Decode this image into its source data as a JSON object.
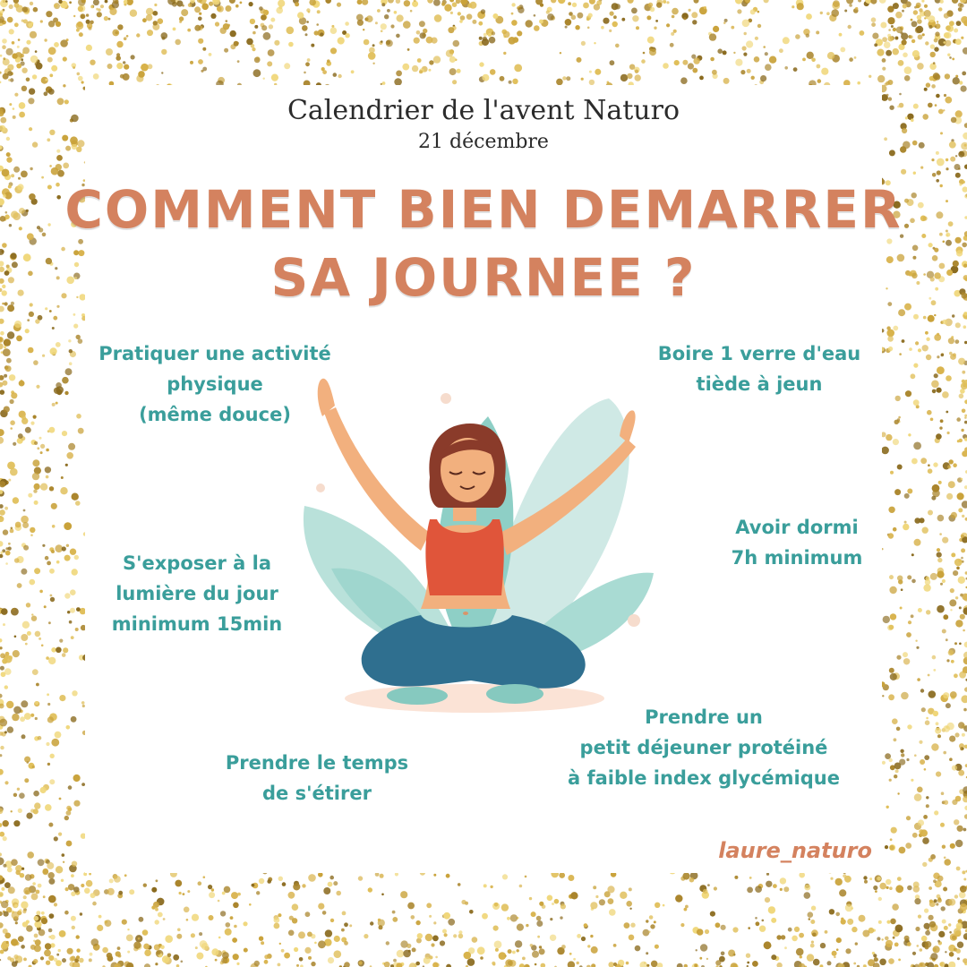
{
  "header": {
    "title": "Calendrier de l'avent Naturo",
    "date": "21 décembre"
  },
  "headline": {
    "line1": "COMMENT BIEN DEMARRER",
    "line2": "SA JOURNEE ?"
  },
  "tips": {
    "activity": [
      "Pratiquer une activité",
      "physique",
      "(même douce)"
    ],
    "water": [
      "Boire 1 verre d'eau",
      "tiède à jeun"
    ],
    "daylight": [
      "S'exposer à la",
      "lumière du jour",
      "minimum 15min"
    ],
    "sleep": [
      "Avoir dormi",
      "7h minimum"
    ],
    "stretch": [
      "Prendre le temps",
      "de s'étirer"
    ],
    "breakfast": [
      "Prendre un",
      "petit déjeuner protéiné",
      "à faible index glycémique"
    ]
  },
  "author": "laure_naturo",
  "colors": {
    "accent": "#d4825f",
    "tip_text": "#3a9e9b",
    "glitter_gold": "#c9a23a",
    "leaf_teal": "#8ecfc6",
    "top_orange": "#e0553a",
    "pants_blue": "#2f6f8f"
  },
  "icons": {
    "frame": "gold-glitter-frame",
    "illustration": "woman-meditating-illustration"
  }
}
